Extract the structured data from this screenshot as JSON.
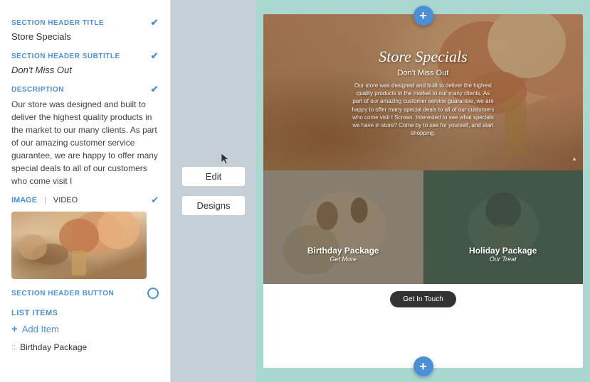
{
  "leftPanel": {
    "sectionHeaderTitleLabel": "SECTION HEADER TITLE",
    "sectionHeaderTitleValue": "Store Specials",
    "sectionHeaderSubtitleLabel": "SECTION HEADER SUBTITLE",
    "sectionHeaderSubtitleValue": "Don't Miss Out",
    "descriptionLabel": "DESCRIPTION",
    "descriptionValue": "Our store was designed and built to deliver the highest quality products in the market to our many clients. As part of our amazing customer service guarantee, we are happy to offer many special deals to all of our customers who come visit I",
    "imageTabLabel": "IMAGE",
    "videoTabLabel": "VIDEO",
    "sectionHeaderButtonLabel": "SECTION HEADER BUTTON",
    "listItemsLabel": "LIST ITEMS",
    "addItemLabel": "Add Item",
    "listItem1Label": "Birthday Package"
  },
  "middlePanel": {
    "editLabel": "Edit",
    "designsLabel": "Designs"
  },
  "rightPanel": {
    "heroTitle": "Store Specials",
    "heroSubtitle": "Don't Miss Out",
    "heroDescription": "Our store was designed and built to deliver the highest quality products in the market to our many clients. As part of our amazing customer service guarantee, we are happy to offer many special deals to all of our customers who come visit I Screan. Interested to see what specials we have in store? Come by to see for yourself, and start shopping.",
    "product1Title": "Birthday Package",
    "product1Subtitle": "Get More",
    "product2Title": "Holiday Package",
    "product2Subtitle": "Our Treat",
    "ctaButtonLabel": "Get In Touch",
    "plusIcon": "+",
    "watermark": "▲"
  }
}
